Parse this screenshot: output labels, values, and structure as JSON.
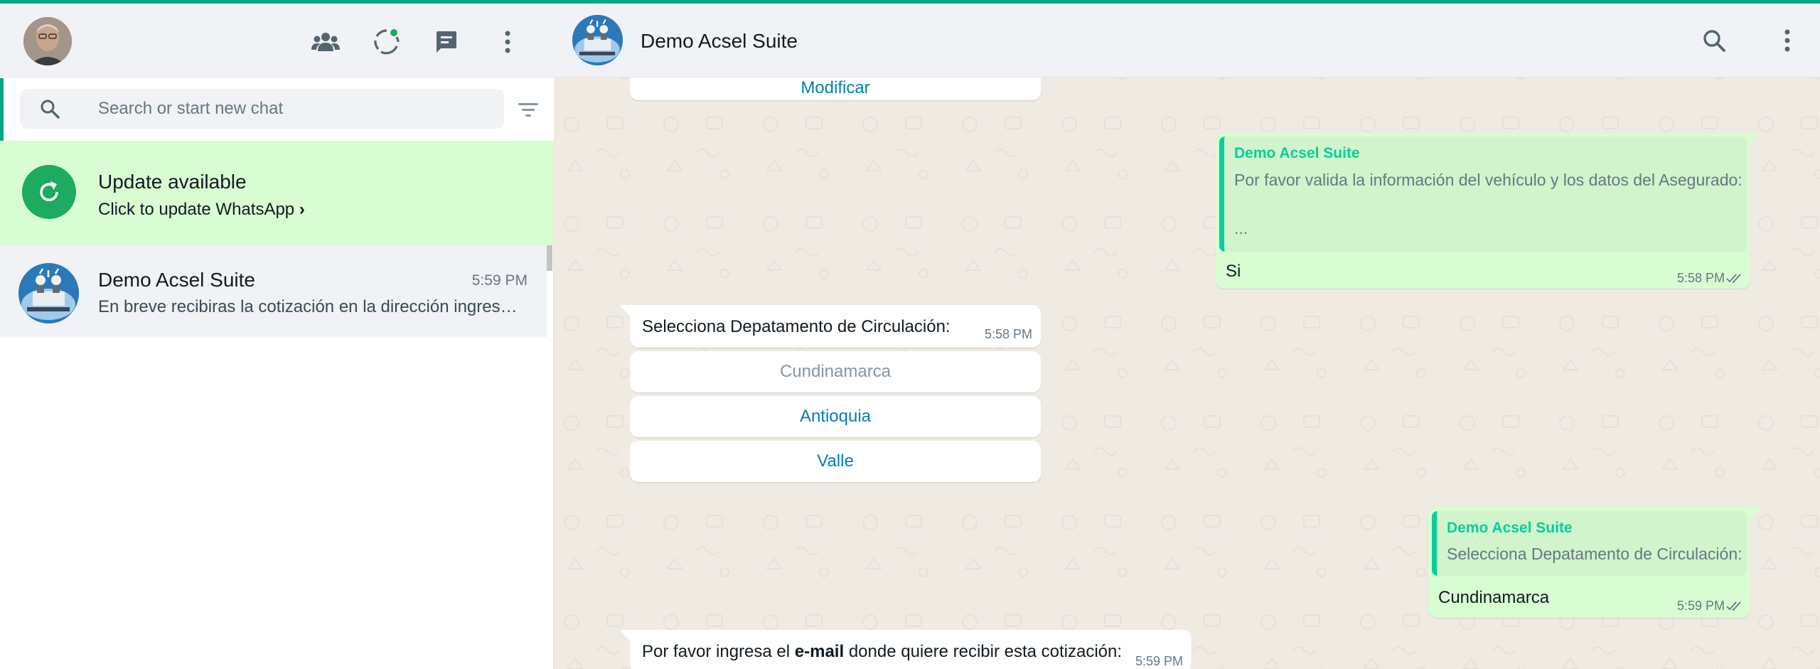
{
  "colors": {
    "accent": "#00a884",
    "update_banner": "#d9fdd3",
    "update_circle": "#1daa61",
    "chat_background": "#efeae2",
    "outgoing_bubble": "#d9fdd3",
    "quote_accent": "#06cf9c",
    "button_link": "#027eb5"
  },
  "sidebar": {
    "header": {
      "avatar_icon": "user-avatar",
      "icons": [
        "communities-icon",
        "status-icon",
        "new-chat-icon",
        "menu-icon"
      ]
    },
    "search": {
      "placeholder": "Search or start new chat",
      "value": "",
      "search_icon": "search-icon",
      "filter_icon": "filter-icon"
    },
    "update_banner": {
      "title": "Update available",
      "subtitle": "Click to update WhatsApp",
      "arrow": "›",
      "icon": "refresh-icon"
    },
    "chats": [
      {
        "name": "Demo Acsel Suite",
        "time": "5:59 PM",
        "preview": "En breve recibiras la cotización en la dirección ingresada"
      }
    ]
  },
  "conversation": {
    "header": {
      "name": "Demo Acsel Suite",
      "icons": [
        "search-icon",
        "menu-icon"
      ]
    },
    "messages": {
      "modificar_button": "Modificar",
      "reply1": {
        "quote_author": "Demo Acsel Suite",
        "quote_line1": "Por favor valida la información del vehículo y los datos del Asegurado:",
        "quote_line2": "...",
        "text": "Si",
        "time": "5:58 PM"
      },
      "incoming_select": {
        "text": "Selecciona Depatamento de Circulación:",
        "time": "5:58 PM",
        "options": [
          "Cundinamarca",
          "Antioquia",
          "Valle"
        ]
      },
      "reply2": {
        "quote_author": "Demo Acsel Suite",
        "quote_line1": "Selecciona Depatamento de Circulación:",
        "text": "Cundinamarca",
        "time": "5:59 PM"
      },
      "incoming_email": {
        "text_before": "Por favor ingresa el ",
        "text_bold": "e-mail",
        "text_after": " donde quiere recibir esta cotización:",
        "time": "5:59 PM"
      }
    }
  }
}
